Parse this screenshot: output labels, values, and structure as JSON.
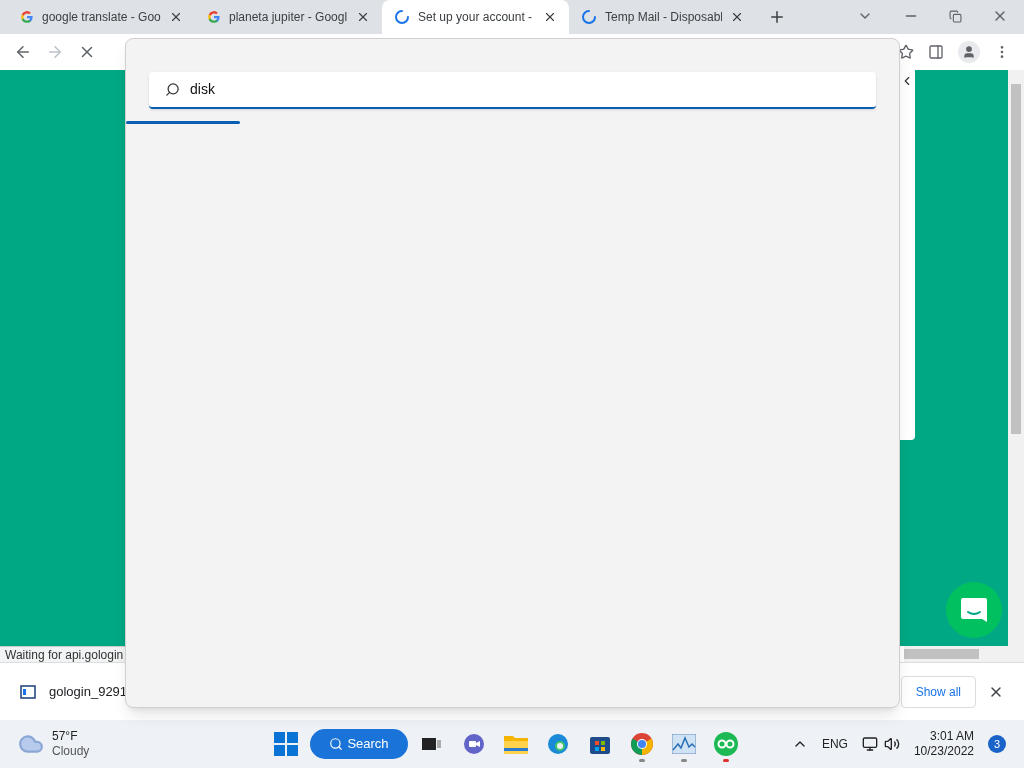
{
  "browser": {
    "tabs": [
      {
        "title": "google translate - Goo",
        "kind": "google",
        "selected": false
      },
      {
        "title": "planeta jupiter - Googl",
        "kind": "google",
        "selected": false
      },
      {
        "title": "Set up your account -",
        "kind": "loading",
        "selected": true
      },
      {
        "title": "Temp Mail - Disposabl",
        "kind": "loading",
        "selected": false
      }
    ],
    "status_text": "Waiting for api.gologin",
    "download": {
      "file_name": "gologin_9291",
      "show_all": "Show all"
    }
  },
  "search_panel": {
    "query": "disk"
  },
  "taskbar": {
    "weather": {
      "temperature": "57°F",
      "condition": "Cloudy"
    },
    "search_label": "Search",
    "language": "ENG",
    "time": "3:01 AM",
    "date": "10/23/2022",
    "notification_count": "3"
  }
}
